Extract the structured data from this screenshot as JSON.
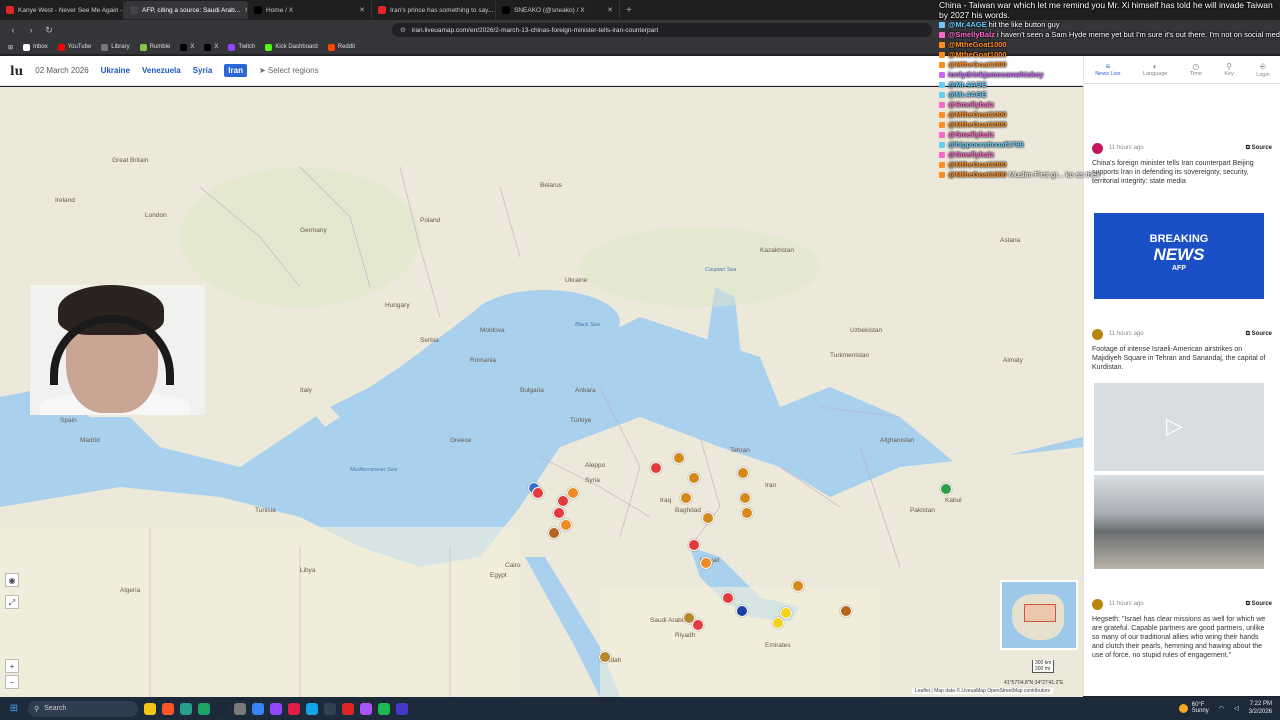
{
  "browser": {
    "tabs": [
      {
        "title": "Kanye West - Never See Me Again -",
        "active": false,
        "color": "#e02525"
      },
      {
        "title": "AFP, citing a source: Saudi Arab...",
        "active": true,
        "color": "#444444"
      },
      {
        "title": "Home / X",
        "active": false,
        "color": "#000000"
      },
      {
        "title": "Iran's prince has something to say...",
        "active": false,
        "color": "#e02525"
      },
      {
        "title": "SNEAKO (@sneako) / X",
        "active": false,
        "color": "#000000"
      }
    ],
    "new_tab": "+",
    "url": "iran.liveuamap.com/en/2026/2-march-13-chinas-foreign-minister-tells-iran-counterpart",
    "bookmarks": [
      {
        "label": "Inbox",
        "color": "#ffffff"
      },
      {
        "label": "YouTube",
        "color": "#ff0000"
      },
      {
        "label": "Library",
        "color": "#777777"
      },
      {
        "label": "Rumble",
        "color": "#85c742"
      },
      {
        "label": "X",
        "color": "#000000"
      },
      {
        "label": "X",
        "color": "#000000"
      },
      {
        "label": "Twitch",
        "color": "#9146ff"
      },
      {
        "label": "Kick Dashboard",
        "color": "#53fc18"
      },
      {
        "label": "Reddit",
        "color": "#ff4500"
      }
    ]
  },
  "site": {
    "logo": "lu",
    "date": "02 March 2026",
    "regions": [
      "Ukraine",
      "Venezuela",
      "Syria",
      "Iran"
    ],
    "active_region": "Iran",
    "select_regions": "Select regions"
  },
  "map": {
    "labels": [
      {
        "text": "Great Britain"
      },
      {
        "text": "Ireland"
      },
      {
        "text": "London"
      },
      {
        "text": "Paris"
      },
      {
        "text": "France"
      },
      {
        "text": "Spain"
      },
      {
        "text": "Madrid"
      },
      {
        "text": "Italy"
      },
      {
        "text": "Germany"
      },
      {
        "text": "Poland"
      },
      {
        "text": "Hungary"
      },
      {
        "text": "Belarus"
      },
      {
        "text": "Ukraine"
      },
      {
        "text": "Moldova"
      },
      {
        "text": "Romania"
      },
      {
        "text": "Bulgaria"
      },
      {
        "text": "Serbia"
      },
      {
        "text": "Greece"
      },
      {
        "text": "Türkiye"
      },
      {
        "text": "Ankara"
      },
      {
        "text": "Kazakhstan"
      },
      {
        "text": "Uzbekistan"
      },
      {
        "text": "Turkmenistan"
      },
      {
        "text": "Afghanistan"
      },
      {
        "text": "Pakistan"
      },
      {
        "text": "Iran"
      },
      {
        "text": "Iraq"
      },
      {
        "text": "Syria"
      },
      {
        "text": "Egypt"
      },
      {
        "text": "Libya"
      },
      {
        "text": "Algeria"
      },
      {
        "text": "Tunisia"
      },
      {
        "text": "Saudi Arabia"
      },
      {
        "text": "Riyadh"
      },
      {
        "text": "Cairo"
      },
      {
        "text": "Baghdad"
      },
      {
        "text": "Tehran"
      },
      {
        "text": "Aleppo"
      },
      {
        "text": "Kabul"
      },
      {
        "text": "Emirates"
      },
      {
        "text": "Kuwait"
      },
      {
        "text": "Jeddah"
      },
      {
        "text": "Mediterranean Sea"
      },
      {
        "text": "Black Sea"
      },
      {
        "text": "Caspian Sea"
      },
      {
        "text": "Almaty"
      },
      {
        "text": "Astana"
      }
    ],
    "attribution": "Leaflet | Map data © LiveuaMap OpenStreetMap contributors",
    "scale_km": "300 km",
    "scale_mi": "200 mi",
    "coords": "41°57′04.8″N 34°27′41.2″E",
    "controls": [
      "+",
      "−"
    ]
  },
  "chat": {
    "top_message": "China - Taiwan war which let me remind you Mr. Xi himself has told he will invade Taiwan by 2027 his words.",
    "lines": [
      {
        "user": "@Mr.4AGE",
        "text": "hit the like button guy",
        "color": "#66ccff"
      },
      {
        "user": "@SmellyBalz",
        "text": "i haven't seen a Sam Hyde meme yet but I'm sure it's out there. I'm not on social media so there's that.",
        "color": "#ff66cc"
      },
      {
        "user": "@MtheGoat1000",
        "text": "",
        "color": "#ff8c1a"
      },
      {
        "user": "@MtheGoat1000",
        "text": "",
        "color": "#ff8c1a"
      },
      {
        "user": "@MtheGoat1000",
        "text": "",
        "color": "#ff8c1a"
      },
      {
        "user": "ionlydrinkjamesonwhiskey",
        "text": "",
        "color": "#cc66ff"
      },
      {
        "user": "@Mr.4AGE",
        "text": "",
        "color": "#66ccff"
      },
      {
        "user": "@Mr.4AGE",
        "text": "",
        "color": "#66ccff"
      },
      {
        "user": "@Smellybalz",
        "text": "",
        "color": "#ff66cc"
      },
      {
        "user": "@MtheGoat1000",
        "text": "",
        "color": "#ff8c1a"
      },
      {
        "user": "@MtheGoat1000",
        "text": "",
        "color": "#ff8c1a"
      },
      {
        "user": "@Smellybalz",
        "text": "",
        "color": "#ff66cc"
      },
      {
        "user": "@hippocraticoaf1798",
        "text": "",
        "color": "#66ccff"
      },
      {
        "user": "@Smellybalz",
        "text": "",
        "color": "#ff66cc"
      },
      {
        "user": "@MtheGoat1000",
        "text": "",
        "color": "#ff8c1a"
      },
      {
        "user": "@MtheGoat1000",
        "text": "Muslim First gr... ko as their",
        "color": "#ff8c1a"
      }
    ]
  },
  "sidebar": {
    "tabs": [
      {
        "label": "News Live",
        "icon": "≡"
      },
      {
        "label": "Language",
        "icon": "◐"
      },
      {
        "label": "Time",
        "icon": "◷"
      },
      {
        "label": "Key",
        "icon": "⚲"
      },
      {
        "label": "Login",
        "icon": "⎆"
      }
    ],
    "posts": [
      {
        "time": "11 hours ago",
        "source": "Source",
        "text": "China's foreign minister tells Iran counterpart Beijing supports Iran in defending its sovereignty, security, territorial integrity: state media",
        "image": "breaking",
        "icon_color": "#c2185b"
      },
      {
        "time": "11 hours ago",
        "source": "Source",
        "text": "Footage of intense Israeli-American airstrikes on Majidiyeh Square in Tehran and Sanandaj, the capital of Kurdistan.",
        "image": "photos",
        "icon_color": "#b8860b"
      },
      {
        "time": "11 hours ago",
        "source": "Source",
        "text": "Hegseth: \"Israel has clear missions as well for which we are grateful. Capable partners are good partners, unlike so many of our traditional allies who wring their hands and clutch their pearls, hemming and hawing about the use of force. no stupid rules of engagement.\"",
        "image": "",
        "icon_color": "#b8860b"
      }
    ],
    "breaking_label_1": "BREAKING",
    "breaking_label_2": "NEWS",
    "breaking_label_3": "AFP"
  },
  "taskbar": {
    "search": "Search",
    "weather_temp": "60°F",
    "weather_desc": "Sunny",
    "time": "7:22 PM",
    "date": "3/2/2026"
  }
}
